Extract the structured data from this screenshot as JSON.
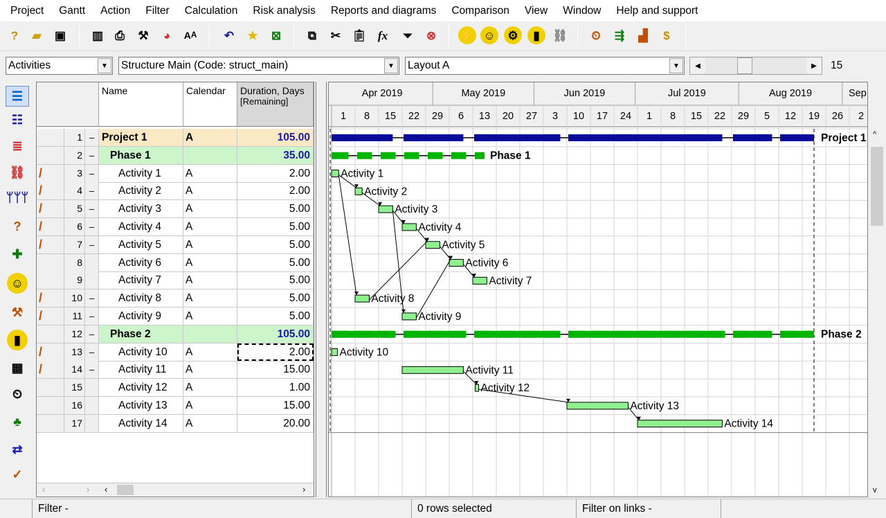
{
  "menu": [
    "Project",
    "Gantt",
    "Action",
    "Filter",
    "Calculation",
    "Risk analysis",
    "Reports and diagrams",
    "Comparison",
    "View",
    "Window",
    "Help and support"
  ],
  "combos": {
    "view": "Activities",
    "structure": "Structure Main (Code: struct_main)",
    "layout": "Layout A",
    "zoom": "15"
  },
  "grid": {
    "headers": {
      "name": "Name",
      "calendar": "Calendar",
      "duration_line1": "Duration, Days",
      "duration_line2": "[Remaining]"
    },
    "rows": [
      {
        "num": "1",
        "collapse": "–",
        "name": "Project 1",
        "cal": "A",
        "dur": "105.00",
        "type": "proj",
        "pencil": false
      },
      {
        "num": "2",
        "collapse": "–",
        "name": "Phase 1",
        "cal": "",
        "dur": "35.00",
        "type": "phase",
        "pencil": false
      },
      {
        "num": "3",
        "collapse": "–",
        "name": "Activity 1",
        "cal": "A",
        "dur": "2.00",
        "type": "act",
        "pencil": true
      },
      {
        "num": "4",
        "collapse": "–",
        "name": "Activity 2",
        "cal": "A",
        "dur": "2.00",
        "type": "act",
        "pencil": true
      },
      {
        "num": "5",
        "collapse": "–",
        "name": "Activity 3",
        "cal": "A",
        "dur": "5.00",
        "type": "act",
        "pencil": true
      },
      {
        "num": "6",
        "collapse": "–",
        "name": "Activity 4",
        "cal": "A",
        "dur": "5.00",
        "type": "act",
        "pencil": true
      },
      {
        "num": "7",
        "collapse": "–",
        "name": "Activity 5",
        "cal": "A",
        "dur": "5.00",
        "type": "act",
        "pencil": true
      },
      {
        "num": "8",
        "collapse": "",
        "name": "Activity 6",
        "cal": "A",
        "dur": "5.00",
        "type": "act",
        "pencil": false
      },
      {
        "num": "9",
        "collapse": "",
        "name": "Activity 7",
        "cal": "A",
        "dur": "5.00",
        "type": "act",
        "pencil": false
      },
      {
        "num": "10",
        "collapse": "–",
        "name": "Activity 8",
        "cal": "A",
        "dur": "5.00",
        "type": "act",
        "pencil": true
      },
      {
        "num": "11",
        "collapse": "–",
        "name": "Activity 9",
        "cal": "A",
        "dur": "5.00",
        "type": "act",
        "pencil": true
      },
      {
        "num": "12",
        "collapse": "–",
        "name": "Phase 2",
        "cal": "",
        "dur": "105.00",
        "type": "phase",
        "pencil": false
      },
      {
        "num": "13",
        "collapse": "–",
        "name": "Activity 10",
        "cal": "A",
        "dur": "2.00",
        "type": "act",
        "pencil": true
      },
      {
        "num": "14",
        "collapse": "–",
        "name": "Activity 11",
        "cal": "A",
        "dur": "15.00",
        "type": "act",
        "pencil": true
      },
      {
        "num": "15",
        "collapse": "",
        "name": "Activity 12",
        "cal": "A",
        "dur": "1.00",
        "type": "act",
        "pencil": false
      },
      {
        "num": "16",
        "collapse": "",
        "name": "Activity 13",
        "cal": "A",
        "dur": "15.00",
        "type": "act",
        "pencil": false
      },
      {
        "num": "17",
        "collapse": "",
        "name": "Activity 14",
        "cal": "A",
        "dur": "20.00",
        "type": "act",
        "pencil": false
      }
    ]
  },
  "gantt": {
    "months": [
      "Apr 2019",
      "May 2019",
      "Jun 2019",
      "Jul 2019",
      "Aug 2019",
      "Sep"
    ],
    "weeks": [
      "1",
      "8",
      "15",
      "22",
      "29",
      "6",
      "13",
      "20",
      "27",
      "3",
      "10",
      "17",
      "24",
      "1",
      "8",
      "15",
      "22",
      "29",
      "5",
      "12",
      "19",
      "26",
      "2"
    ],
    "bars": [
      {
        "label": "Project 1",
        "type": "proj",
        "start": 0,
        "end": 20.5
      },
      {
        "label": "Phase 1",
        "type": "phase",
        "start": 0,
        "end": 6.5
      },
      {
        "label": "Activity 1",
        "type": "act",
        "start": 0,
        "end": 0.3
      },
      {
        "label": "Activity 2",
        "type": "act",
        "start": 1,
        "end": 1.3
      },
      {
        "label": "Activity 3",
        "type": "act",
        "start": 2,
        "end": 2.6
      },
      {
        "label": "Activity 4",
        "type": "act",
        "start": 3,
        "end": 3.6
      },
      {
        "label": "Activity 5",
        "type": "act",
        "start": 4,
        "end": 4.6
      },
      {
        "label": "Activity 6",
        "type": "act",
        "start": 5,
        "end": 5.6
      },
      {
        "label": "Activity 7",
        "type": "act",
        "start": 6,
        "end": 6.6
      },
      {
        "label": "Activity 8",
        "type": "act",
        "start": 1,
        "end": 1.6
      },
      {
        "label": "Activity 9",
        "type": "act",
        "start": 3,
        "end": 3.6
      },
      {
        "label": "Phase 2",
        "type": "phase",
        "start": 0,
        "end": 20.5
      },
      {
        "label": "Activity 10",
        "type": "act",
        "start": 0,
        "end": 0.25
      },
      {
        "label": "Activity 11",
        "type": "act",
        "start": 3,
        "end": 5.6
      },
      {
        "label": "Activity 12",
        "type": "act",
        "start": 6.1,
        "end": 6.25
      },
      {
        "label": "Activity 13",
        "type": "act",
        "start": 10,
        "end": 12.6
      },
      {
        "label": "Activity 14",
        "type": "act",
        "start": 13,
        "end": 16.6
      }
    ],
    "links": [
      [
        2,
        3
      ],
      [
        3,
        4
      ],
      [
        4,
        5
      ],
      [
        5,
        6
      ],
      [
        6,
        7
      ],
      [
        7,
        8
      ],
      [
        2,
        9
      ],
      [
        9,
        6
      ],
      [
        4,
        10
      ],
      [
        10,
        7
      ],
      [
        13,
        14
      ],
      [
        14,
        15
      ],
      [
        15,
        16
      ]
    ]
  },
  "status": {
    "filter": "Filter -",
    "selected": "0 rows selected",
    "filter_links": "Filter on links -"
  },
  "colors": {
    "proj_bar": "#0a0a9a",
    "phase_bar": "#00b400",
    "act_bar": "#8ef08e",
    "proj_row": "#fbe9c6",
    "phase_row": "#ccf5cc"
  }
}
